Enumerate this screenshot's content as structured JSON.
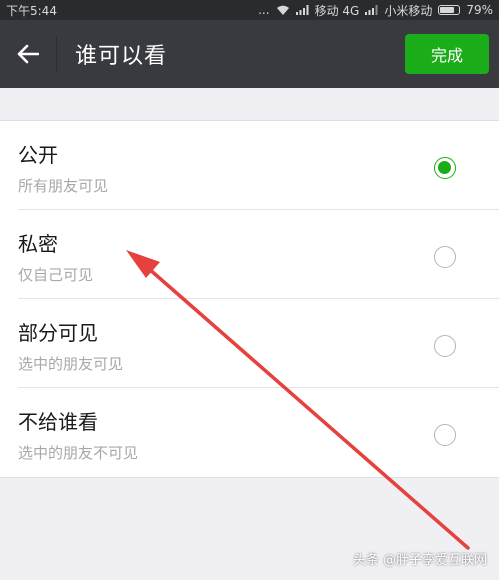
{
  "status_bar": {
    "time": "下午5:44",
    "network": "... ",
    "carrier1": "移动 4G",
    "carrier2": "小米移动",
    "battery": "79%",
    "battery_level": 0.79
  },
  "nav": {
    "title": "谁可以看",
    "done_label": "完成"
  },
  "options": [
    {
      "title": "公开",
      "subtitle": "所有朋友可见",
      "selected": true
    },
    {
      "title": "私密",
      "subtitle": "仅自己可见",
      "selected": false
    },
    {
      "title": "部分可见",
      "subtitle": "选中的朋友可见",
      "selected": false
    },
    {
      "title": "不给谁看",
      "subtitle": "选中的朋友不可见",
      "selected": false
    }
  ],
  "colors": {
    "accent": "#1aad19",
    "nav_bg": "#393a3f",
    "annotation_arrow": "#e5413e"
  },
  "watermark": "头条 @胖子孪爱互联网"
}
